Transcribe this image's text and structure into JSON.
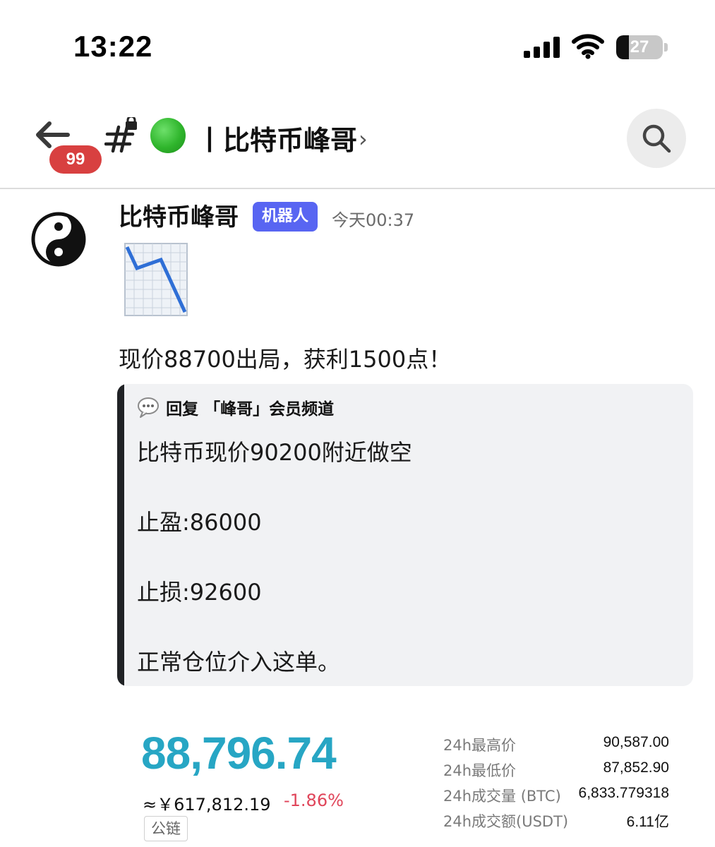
{
  "status_bar": {
    "time": "13:22",
    "battery_level": "27"
  },
  "header": {
    "unread_count": "99",
    "channel_title": "丨比特币峰哥",
    "chevron": "›"
  },
  "message": {
    "author": "比特币峰哥",
    "bot_tag": "机器人",
    "timestamp": "今天00:37",
    "emoji": "chart-decreasing",
    "text": "现价88700出局，获利1500点！"
  },
  "reply": {
    "header": "回复 「峰哥」会员频道",
    "lines": [
      "比特币现价90200附近做空",
      "止盈:86000",
      "止损:92600",
      "正常仓位介入这单。"
    ]
  },
  "price_card": {
    "price": "88,796.74",
    "cny": "≈￥617,812.19",
    "change": "-1.86%",
    "chain_tag": "公链",
    "stats": [
      {
        "label": "24h最高价",
        "value": "90,587.00"
      },
      {
        "label": "24h最低价",
        "value": "87,852.90"
      },
      {
        "label": "24h成交量 (BTC)",
        "value": "6,833.779318"
      },
      {
        "label": "24h成交额(USDT)",
        "value": "6.11亿"
      }
    ]
  },
  "colors": {
    "accent_blue": "#5865f2",
    "price_teal": "#27a6c4",
    "down_red": "#e0455a",
    "badge_red": "#d84040"
  }
}
